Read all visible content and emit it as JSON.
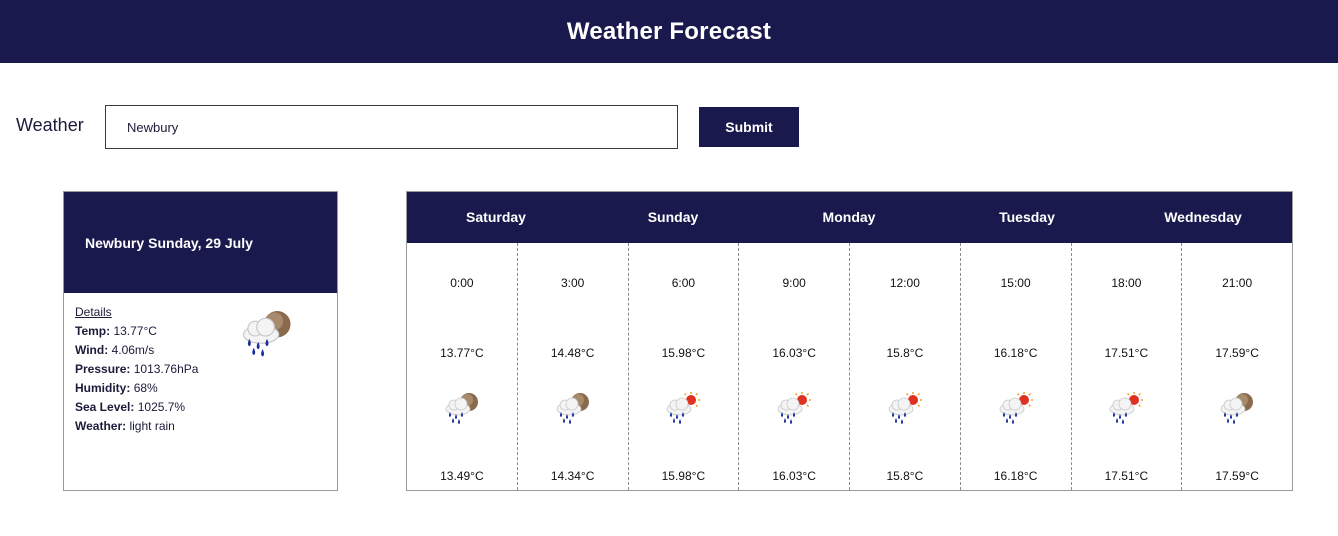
{
  "header": {
    "title": "Weather Forecast"
  },
  "search": {
    "label": "Weather",
    "value": "Newbury",
    "submit_label": "Submit"
  },
  "current": {
    "city": "Newbury",
    "date": "Sunday, 29 July",
    "details_label": "Details",
    "temp_label": "Temp:",
    "temp": "13.77°C",
    "wind_label": "Wind:",
    "wind": "4.06m/s",
    "pressure_label": "Pressure:",
    "pressure": "1013.76hPa",
    "humidity_label": "Humidity:",
    "humidity": "68%",
    "sea_label": "Sea Level:",
    "sea_level": "1025.7%",
    "weather_label": "Weather:",
    "weather": "light rain",
    "icon": "rain-cloud-moon-icon"
  },
  "forecast": {
    "days": [
      "Saturday",
      "Sunday",
      "Monday",
      "Tuesday",
      "Wednesday"
    ],
    "slots": [
      {
        "time": "0:00",
        "temp": "13.77°C",
        "min": "13.49°C",
        "icon": "rain-cloud-moon-icon"
      },
      {
        "time": "3:00",
        "temp": "14.48°C",
        "min": "14.34°C",
        "icon": "rain-cloud-moon-icon"
      },
      {
        "time": "6:00",
        "temp": "15.98°C",
        "min": "15.98°C",
        "icon": "rain-cloud-sun-icon"
      },
      {
        "time": "9:00",
        "temp": "16.03°C",
        "min": "16.03°C",
        "icon": "rain-cloud-sun-icon"
      },
      {
        "time": "12:00",
        "temp": "15.8°C",
        "min": "15.8°C",
        "icon": "rain-cloud-sun-icon"
      },
      {
        "time": "15:00",
        "temp": "16.18°C",
        "min": "16.18°C",
        "icon": "rain-cloud-sun-icon"
      },
      {
        "time": "18:00",
        "temp": "17.51°C",
        "min": "17.51°C",
        "icon": "rain-cloud-sun-icon"
      },
      {
        "time": "21:00",
        "temp": "17.59°C",
        "min": "17.59°C",
        "icon": "rain-cloud-moon-icon"
      }
    ]
  },
  "colors": {
    "navy": "#19194d",
    "border": "#9a9a9a",
    "rain": "#1a2f9e",
    "moon": "#8a6a4c",
    "sun": "#f0a020"
  }
}
